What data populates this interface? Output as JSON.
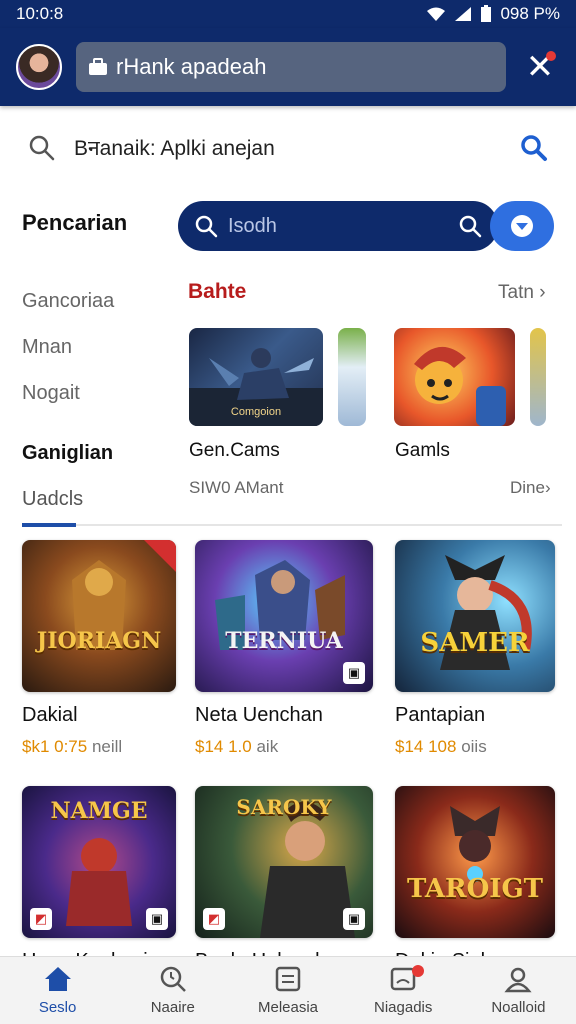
{
  "status_bar": {
    "time": "10:0:8",
    "right_text": "098 P%"
  },
  "app_bar": {
    "field_text": "rHank apadeah"
  },
  "search_row": {
    "placeholder": "Bनanaik: Aplki anejan"
  },
  "pencarian": {
    "label": "Pencarian",
    "query": "Isodh"
  },
  "categories": [
    {
      "label": "Gancoriaa",
      "style": "normal"
    },
    {
      "label": "Mnan",
      "style": "normal"
    },
    {
      "label": "Nogait",
      "style": "normal"
    },
    {
      "label": "Ganiglian",
      "style": "bold"
    },
    {
      "label": "Uadcls",
      "style": "muted"
    }
  ],
  "featured": {
    "title": "Bahte",
    "see_all": "Tatn",
    "items": [
      {
        "name": "Gen.Cams",
        "caption": "Comgoion",
        "subtitle": "SIW0 AMant"
      },
      {
        "name": "Gamls"
      }
    ],
    "more": "Dine"
  },
  "grid": [
    {
      "logo": "JIORIAGN",
      "title": "Dakial",
      "price": "$k1 0:75",
      "price_rest": "neill"
    },
    {
      "logo": "TERNIUA",
      "title": "Neta Uenchan",
      "price": "$14 1.0",
      "price_rest": "aik"
    },
    {
      "logo": "SAMER",
      "title": "Pantapian",
      "price": "$14 108",
      "price_rest": "oiis"
    },
    {
      "logo": "NAMGE",
      "title": "Hana Kaakaui"
    },
    {
      "logo": "SAROKY",
      "title": "Bonla Holanaks"
    },
    {
      "logo": "TAROIGT",
      "title": "Dokie Sioka"
    }
  ],
  "bottom_nav": [
    {
      "label": "Seslo",
      "icon": "home-icon",
      "active": true
    },
    {
      "label": "Naaire",
      "icon": "search-clock-icon",
      "active": false
    },
    {
      "label": "Meleasia",
      "icon": "document-icon",
      "active": false
    },
    {
      "label": "Niagadis",
      "icon": "notification-icon",
      "active": false,
      "badge": true
    },
    {
      "label": "Noalloid",
      "icon": "profile-icon",
      "active": false
    }
  ],
  "colors": {
    "brand": "#0e2a6b",
    "accent": "#2f6fe0",
    "section_title": "#b71c1c",
    "price": "#e08a00"
  }
}
